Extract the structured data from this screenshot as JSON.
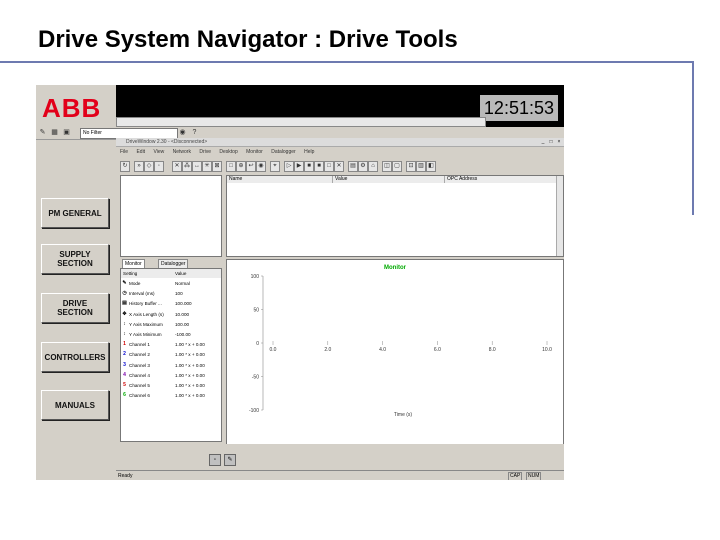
{
  "slide": {
    "title": "Drive System Navigator : Drive Tools"
  },
  "header": {
    "logo": "ABB",
    "clock": "12:51:53"
  },
  "toolbar": {
    "filter_value": "No Filter"
  },
  "nav": [
    {
      "label": "PM GENERAL"
    },
    {
      "label": "SUPPLY SECTION"
    },
    {
      "label": "DRIVE SECTION"
    },
    {
      "label": "CONTROLLERS"
    },
    {
      "label": "MANUALS"
    }
  ],
  "drivewindow": {
    "title": "DriveWindow 2.30 - <Disconnected>",
    "menu": [
      "File",
      "Edit",
      "View",
      "Network",
      "Drive",
      "Desktop",
      "Monitor",
      "Datalogger",
      "Help"
    ],
    "columns": [
      "Name",
      "Value",
      "OPC Address"
    ],
    "tabs": [
      "Monitor",
      "Datalogger"
    ],
    "monitor_headers": [
      "Setting",
      "Value"
    ],
    "monitor_rows": [
      {
        "icon": "mode-icon",
        "glyph": "✎",
        "setting": "Mode",
        "value": "Normal"
      },
      {
        "icon": "interval-icon",
        "glyph": "◷",
        "setting": "Interval (ms)",
        "value": "100"
      },
      {
        "icon": "history-icon",
        "glyph": "▤",
        "setting": "History Buffer ...",
        "value": "100.000"
      },
      {
        "icon": "xaxis-icon",
        "glyph": "✥",
        "setting": "X Axis Length (s)",
        "value": "10.000"
      },
      {
        "icon": "ymax-icon",
        "glyph": "↕",
        "setting": "Y Axis Maximum",
        "value": "100.00"
      },
      {
        "icon": "ymin-icon",
        "glyph": "↕",
        "setting": "Y Axis Minimum",
        "value": "-100.00"
      },
      {
        "icon": "channel1-icon",
        "glyph": "1",
        "color": "#cc0000",
        "setting": "Channel 1",
        "value": "1.00 * x + 0.00"
      },
      {
        "icon": "channel2-icon",
        "glyph": "2",
        "color": "#0000cc",
        "setting": "Channel 2",
        "value": "1.00 * x + 0.00"
      },
      {
        "icon": "channel3-icon",
        "glyph": "3",
        "color": "#0000cc",
        "setting": "Channel 3",
        "value": "1.00 * x + 0.00"
      },
      {
        "icon": "channel4-icon",
        "glyph": "4",
        "color": "#7a00aa",
        "setting": "Channel 4",
        "value": "1.00 * x + 0.00"
      },
      {
        "icon": "channel5-icon",
        "glyph": "5",
        "color": "#cc0000",
        "setting": "Channel 5",
        "value": "1.00 * x + 0.00"
      },
      {
        "icon": "channel6-icon",
        "glyph": "6",
        "color": "#00aa00",
        "setting": "Channel 6",
        "value": "1.00 * x + 0.00"
      }
    ],
    "chart": {
      "title": "Monitor",
      "title_color": "#00aa00",
      "xlabel": "Time (s)",
      "yticks": [
        "100",
        "50",
        "0",
        "-50",
        "-100"
      ],
      "xticks": [
        "0.0",
        "2.0",
        "4.0",
        "6.0",
        "8.0",
        "10.0"
      ]
    },
    "status": {
      "ready": "Ready",
      "cap": "CAP",
      "num": "NUM"
    }
  }
}
